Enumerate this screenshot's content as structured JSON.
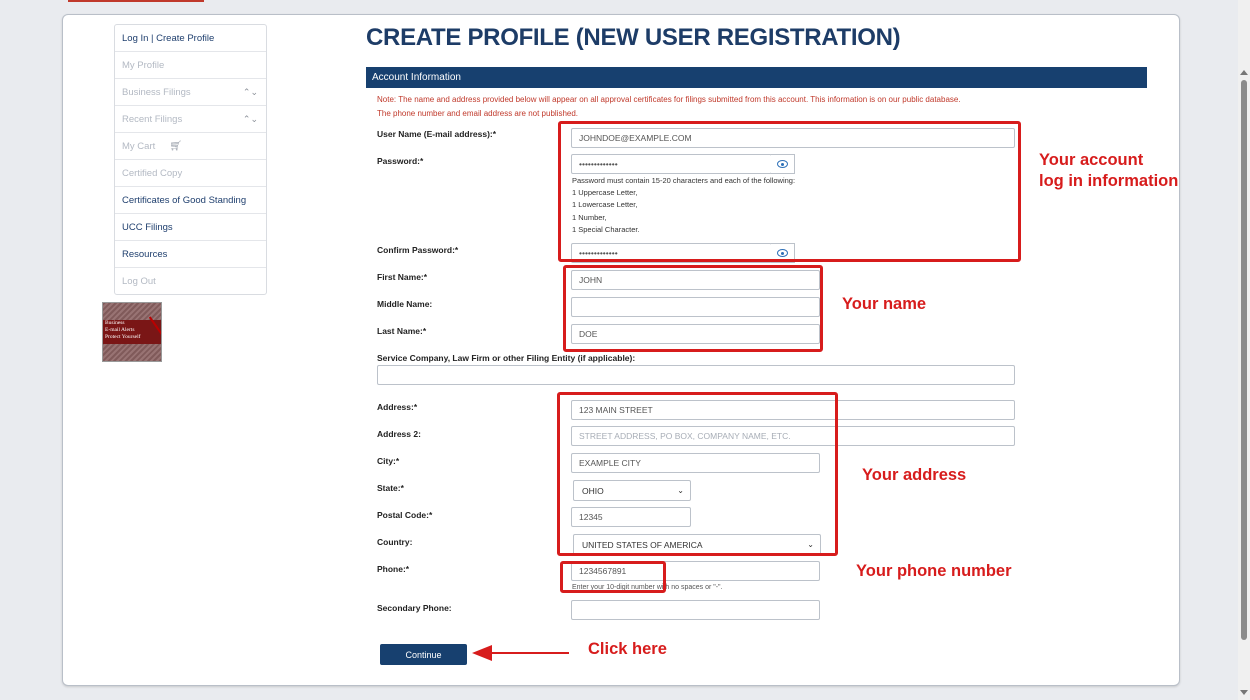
{
  "sidebar": {
    "items": [
      {
        "label": "Log In | Create Profile"
      },
      {
        "label": "My Profile"
      },
      {
        "label": "Business Filings"
      },
      {
        "label": "Recent Filings"
      },
      {
        "label": "My Cart"
      },
      {
        "label": "Certified Copy"
      },
      {
        "label": "Certificates of Good Standing"
      },
      {
        "label": "UCC Filings"
      },
      {
        "label": "Resources"
      },
      {
        "label": "Log Out"
      }
    ],
    "badge": {
      "line1": "Business",
      "line2": "E-mail Alerts",
      "line3": "Protect Yourself"
    }
  },
  "page": {
    "title": "CREATE PROFILE (NEW USER REGISTRATION)",
    "section": "Account Information",
    "note_line1": "Note: The name and address provided below will appear on all approval certificates for filings submitted from this account. This information is on our public database.",
    "note_line2": "The phone number and email address are not published."
  },
  "form": {
    "username": {
      "label": "User Name (E-mail address):*",
      "value": "JOHNDOE@EXAMPLE.COM"
    },
    "password": {
      "label": "Password:*",
      "value": "•••••••••••••"
    },
    "password_help": [
      "Password must contain 15-20 characters and each of the following:",
      "1 Uppercase Letter,",
      "1 Lowercase Letter,",
      "1 Number,",
      "1 Special Character."
    ],
    "confirm_password": {
      "label": "Confirm Password:*",
      "value": "•••••••••••••"
    },
    "first_name": {
      "label": "First Name:*",
      "value": "JOHN"
    },
    "middle_name": {
      "label": "Middle Name:",
      "value": ""
    },
    "last_name": {
      "label": "Last Name:*",
      "value": "DOE"
    },
    "service_company": {
      "label": "Service Company, Law Firm or other Filing Entity (if applicable):",
      "value": ""
    },
    "address": {
      "label": "Address:*",
      "value": "123 MAIN STREET"
    },
    "address2": {
      "label": "Address 2:",
      "placeholder": "STREET ADDRESS, PO BOX, COMPANY NAME, ETC."
    },
    "city": {
      "label": "City:*",
      "value": "EXAMPLE CITY"
    },
    "state": {
      "label": "State:*",
      "value": "OHIO"
    },
    "postal_code": {
      "label": "Postal Code:*",
      "value": "12345"
    },
    "country": {
      "label": "Country:",
      "value": "UNITED STATES OF AMERICA"
    },
    "phone": {
      "label": "Phone:*",
      "value": "1234567891",
      "help": "Enter your 10-digit number with no spaces or \"-\"."
    },
    "secondary_phone": {
      "label": "Secondary Phone:",
      "value": ""
    },
    "continue_label": "Continue"
  },
  "annotations": {
    "account_line1": "Your account",
    "account_line2": "log in information",
    "name": "Your name",
    "address": "Your address",
    "phone": "Your phone number",
    "click": "Click here"
  },
  "colors": {
    "accent": "#d71c1c",
    "brand": "#17406f",
    "title": "#1d3c67",
    "note": "#c0392b"
  }
}
